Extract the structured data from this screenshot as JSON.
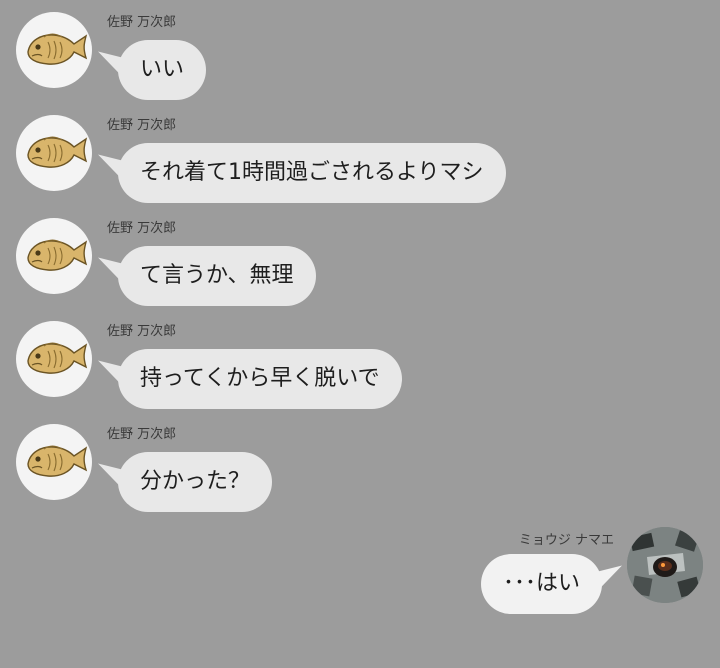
{
  "colors": {
    "background": "#9c9c9c",
    "bubble_left": "#e8e8e8",
    "bubble_right": "#f2f2f2",
    "taiyaki": "#d9b56b"
  },
  "messages": [
    {
      "sender": "佐野 万次郎",
      "text": "いい",
      "avatar_icon": "taiyaki-icon"
    },
    {
      "sender": "佐野 万次郎",
      "text": "それ着て1時間過ごされるよりマシ",
      "avatar_icon": "taiyaki-icon"
    },
    {
      "sender": "佐野 万次郎",
      "text": "て言うか、無理",
      "avatar_icon": "taiyaki-icon"
    },
    {
      "sender": "佐野 万次郎",
      "text": "持ってくから早く脱いで",
      "avatar_icon": "taiyaki-icon"
    },
    {
      "sender": "佐野 万次郎",
      "text": "分かった？",
      "avatar_icon": "taiyaki-icon"
    },
    {
      "sender": "ミョウジ ナマエ",
      "text": "･･･はい",
      "avatar_icon": "photo-avatar-icon"
    }
  ]
}
